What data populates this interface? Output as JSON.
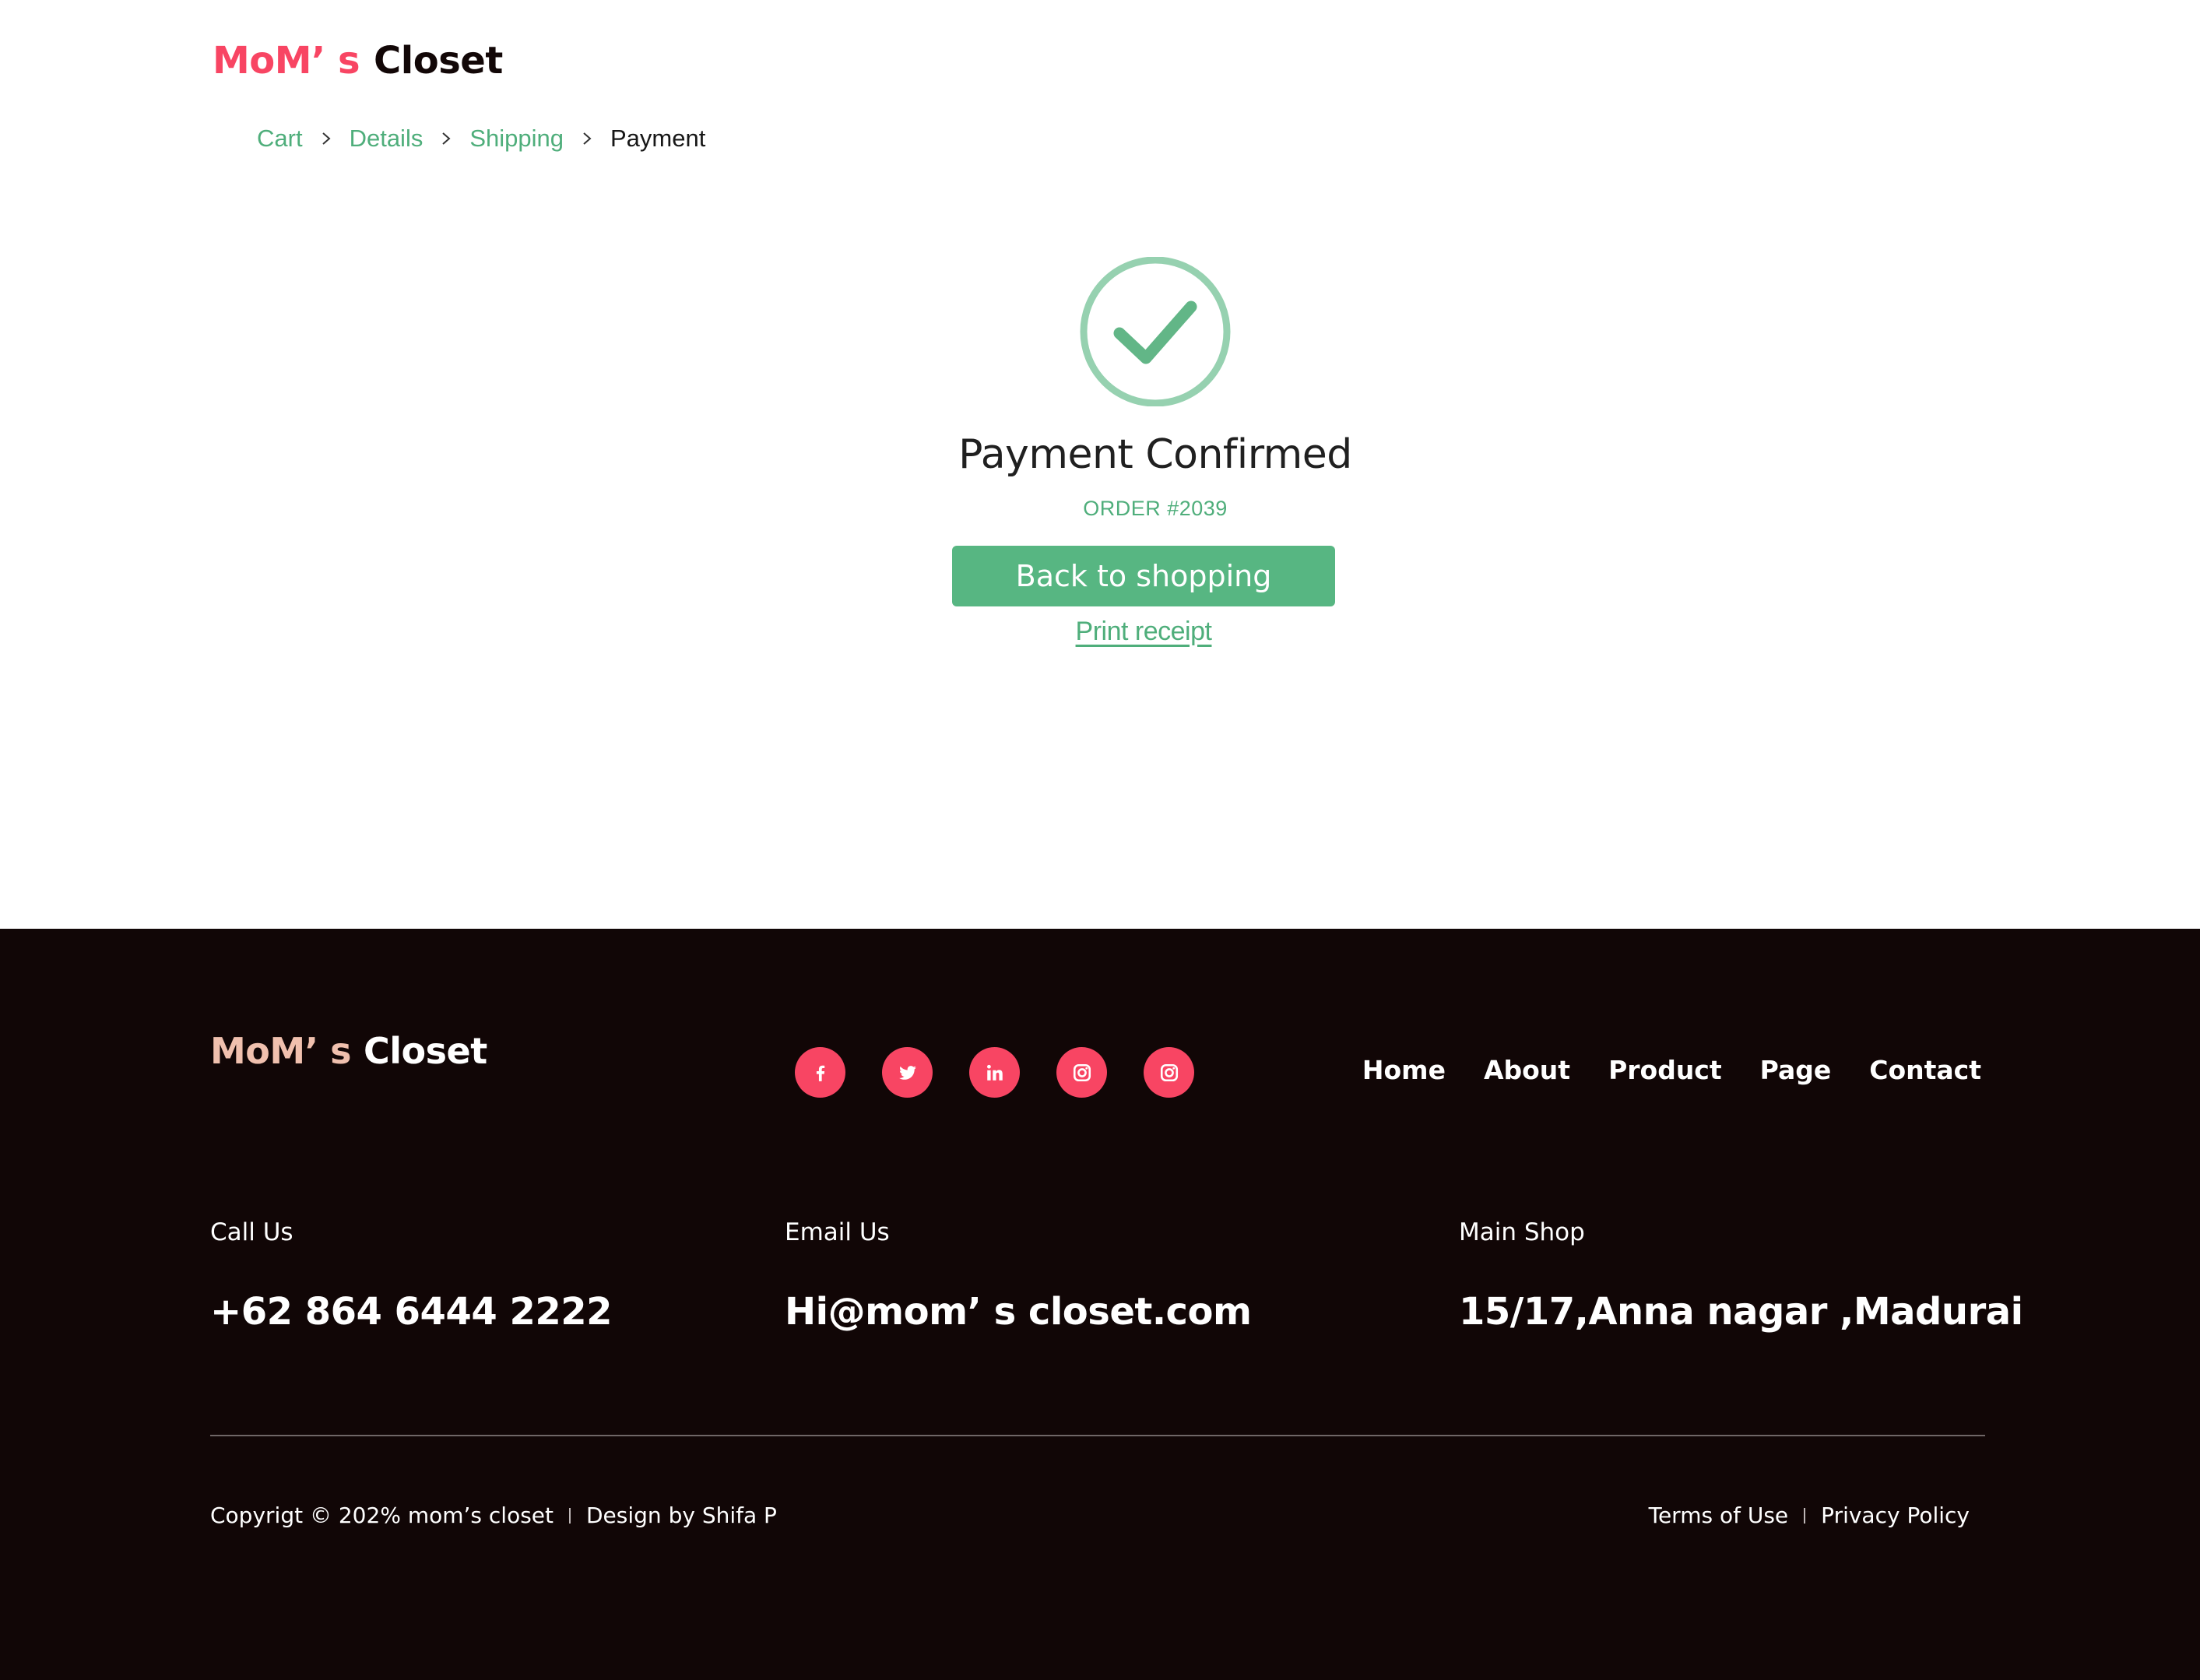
{
  "header": {
    "logo_part1": "MoM’ s",
    "logo_part2": "Closet",
    "breadcrumb": [
      {
        "label": "Cart",
        "state": "done"
      },
      {
        "label": "Details",
        "state": "done"
      },
      {
        "label": "Shipping",
        "state": "done"
      },
      {
        "label": "Payment",
        "state": "current"
      }
    ]
  },
  "confirmation": {
    "icon": "check-circle-icon",
    "title": "Payment Confirmed",
    "order": "ORDER #2039",
    "back_button": "Back to shopping",
    "print_link": "Print receipt"
  },
  "footer": {
    "logo_part1": "MoM’ s",
    "logo_part2": "Closet",
    "socials": [
      "facebook-icon",
      "twitter-icon",
      "linkedin-icon",
      "instagram-icon",
      "instagram-icon"
    ],
    "nav": [
      "Home",
      "About",
      "Product",
      "Page",
      "Contact"
    ],
    "call": {
      "label": "Call Us",
      "value": "+62 864 6444 2222"
    },
    "email": {
      "label": "Email Us",
      "value": "Hi@mom’ s  closet.com"
    },
    "shop": {
      "label": "Main Shop",
      "value": "15/17,Anna nagar ,Madurai"
    },
    "copyright": "Copyrigt © 202% mom’s closet",
    "design": "Design by Shifa P",
    "terms": "Terms of Use",
    "privacy": "Privacy Policy"
  },
  "colors": {
    "brand_pink": "#f84563",
    "accent_green": "#57b682",
    "footer_bg": "#110606"
  }
}
